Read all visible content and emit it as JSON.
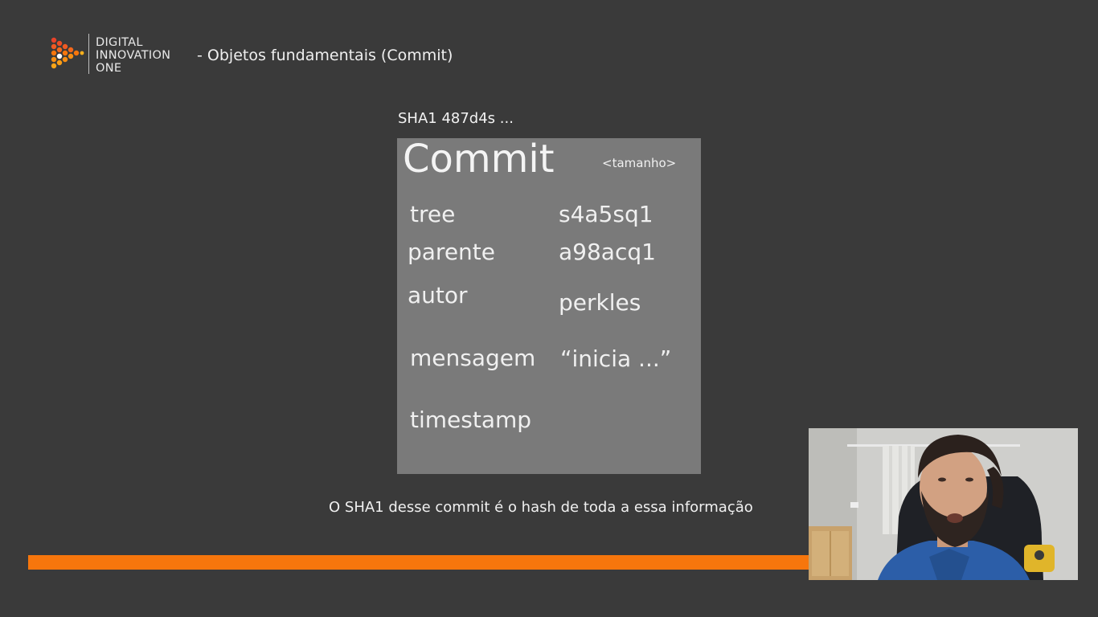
{
  "header": {
    "brand_lines": [
      "DIGITAL",
      "INNOVATION",
      "ONE"
    ],
    "title": "- Objetos fundamentais (Commit)",
    "logo_icon": "digital-innovation-one-logo",
    "logo_colors": [
      "#f7760c",
      "#e8432a",
      "#ffb81c"
    ]
  },
  "slide": {
    "sha_label": "SHA1 487d4s ...",
    "commit": {
      "title": "Commit",
      "size_placeholder": "<tamanho>",
      "fields": {
        "tree": {
          "label": "tree",
          "value": "s4a5sq1"
        },
        "parente": {
          "label": "parente",
          "value": "a98acq1"
        },
        "autor": {
          "label": "autor",
          "value": "perkles"
        },
        "mensagem": {
          "label": "mensagem",
          "value": "“inicia ...”"
        },
        "timestamp": {
          "label": "timestamp"
        }
      }
    },
    "caption": "O SHA1 desse commit é o hash de toda a essa informação"
  },
  "theme": {
    "background": "#3a3a3a",
    "card": "#7a7a7a",
    "accent": "#f7760c"
  },
  "webcam": {
    "icon": "presenter-video"
  }
}
